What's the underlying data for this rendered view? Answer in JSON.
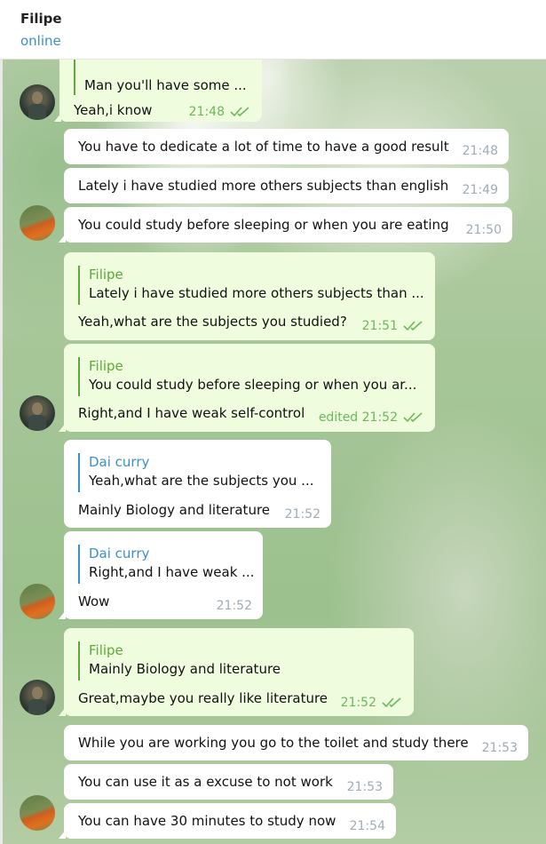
{
  "header": {
    "name": "Filipe",
    "status": "online"
  },
  "messages": [
    {
      "reply_text": "Man you'll have some ...",
      "text": "Yeah,i know",
      "time": "21:48"
    },
    {
      "text": "You have to dedicate a lot of time to have a good result",
      "time": "21:48"
    },
    {
      "text": "Lately i have studied more others subjects than english",
      "time": "21:49"
    },
    {
      "text": "You could study before sleeping or when you are eating",
      "time": "21:50"
    },
    {
      "reply_name": "Filipe",
      "reply_text": "Lately i have studied more others subjects than ...",
      "text": "Yeah,what are the subjects you studied?",
      "time": "21:51"
    },
    {
      "reply_name": "Filipe",
      "reply_text": "You could study before sleeping or when you ar...",
      "text": "Right,and I have weak self-control",
      "time": "edited 21:52"
    },
    {
      "reply_name": "Dai curry",
      "reply_text": "Yeah,what are the subjects you ...",
      "text": "Mainly Biology and literature",
      "time": "21:52"
    },
    {
      "reply_name": "Dai curry",
      "reply_text": "Right,and I have weak ...",
      "text": "Wow",
      "time": "21:52"
    },
    {
      "reply_name": "Filipe",
      "reply_text": "Mainly Biology and literature",
      "text": "Great,maybe you really like literature",
      "time": "21:52"
    },
    {
      "text": "While you are working you go to the toilet and study there",
      "time": "21:53"
    },
    {
      "text": "You can use it as a excuse to not work",
      "time": "21:53"
    },
    {
      "text": "You can have 30 minutes to study now",
      "time": "21:54"
    }
  ],
  "colors": {
    "accent": "#3a8fd0",
    "outgoing_bubble": "#effdde",
    "incoming_bubble": "#ffffff",
    "reply_green": "#5fa83b",
    "read_check": "#6cb85b"
  }
}
